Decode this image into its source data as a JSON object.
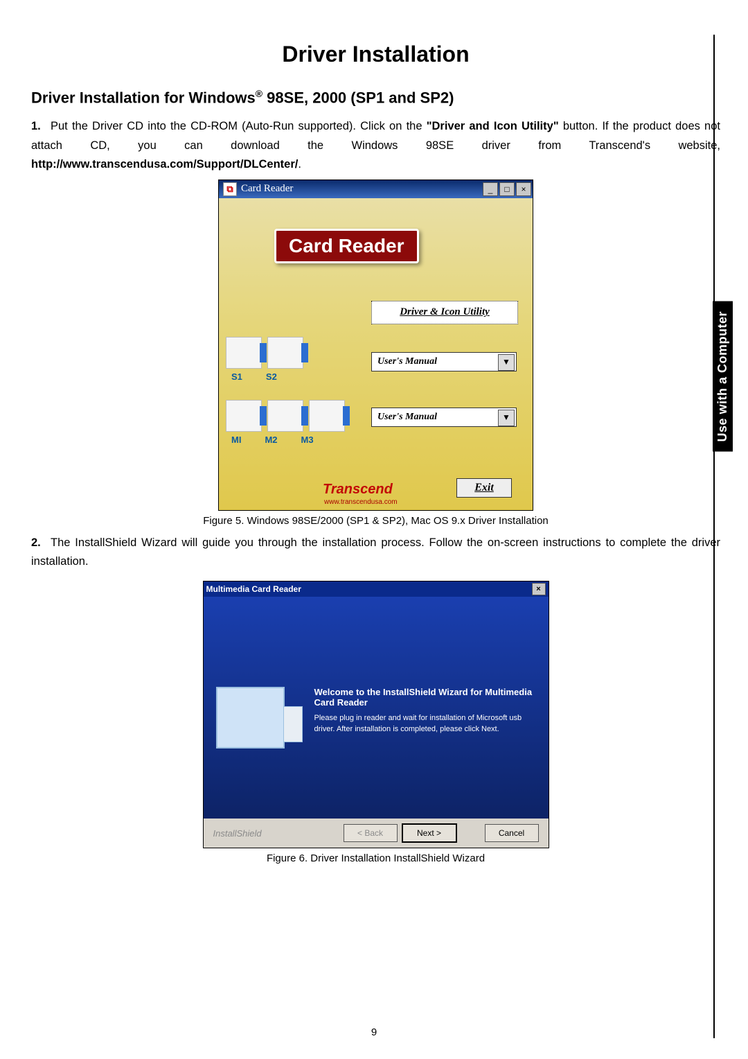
{
  "page": {
    "title": "Driver Installation",
    "subtitle_pre": "Driver Installation for Windows",
    "subtitle_reg": "®",
    "subtitle_post": " 98SE, 2000 (SP1 and SP2)",
    "step1_num": "1.",
    "step1_a": "Put the Driver CD into the CD-ROM (Auto-Run supported). Click on the ",
    "step1_b": "\"Driver and Icon Utility\"",
    "step1_c": " button. If the product does not attach CD, you can download the Windows 98SE driver from Transcend's website, ",
    "step1_url": "http://www.transcendusa.com/Support/DLCenter/",
    "step1_d": ".",
    "step2_num": "2.",
    "step2": "The InstallShield Wizard will guide you through the installation process. Follow the on-screen instructions to complete the driver installation.",
    "fig5_caption": "Figure 5. Windows 98SE/2000 (SP1 & SP2), Mac OS 9.x Driver Installation",
    "fig6_caption": "Figure 6. Driver Installation InstallShield Wizard",
    "page_number": "9",
    "side_tab": "Use with a Computer"
  },
  "fig5": {
    "window_title": "Card Reader",
    "badge": "Card Reader",
    "driver_button": "Driver & Icon Utility",
    "select1": "User's Manual",
    "select2": "User's Manual",
    "labels_row1": [
      "S1",
      "S2"
    ],
    "labels_row2": [
      "MI",
      "M2",
      "M3"
    ],
    "brand": "Transcend",
    "brand_url": "www.transcendusa.com",
    "exit": "Exit"
  },
  "fig6": {
    "window_title": "Multimedia Card Reader",
    "welcome": "Welcome to the InstallShield Wizard for Multimedia Card Reader",
    "desc": "Please plug in reader and wait for installation of Microsoft usb driver. After installation is completed, please click Next.",
    "ishield": "InstallShield",
    "back": "< Back",
    "next": "Next >",
    "cancel": "Cancel"
  }
}
